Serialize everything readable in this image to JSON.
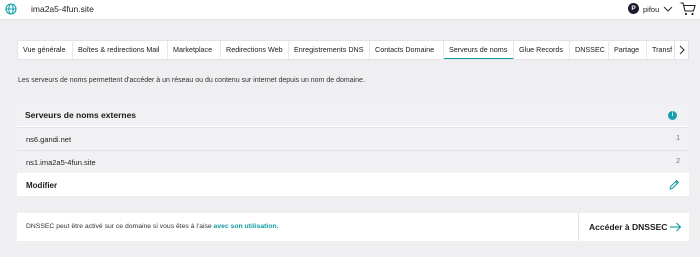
{
  "topbar": {
    "domain": "ima2a5-4fun.site",
    "avatar_initial": "P",
    "username": "pifou",
    "icons": {
      "site": "globe-icon",
      "account_menu": "chevron-down-icon",
      "cart": "cart-icon"
    }
  },
  "tabs": [
    {
      "label": "Vue générale",
      "active": false
    },
    {
      "label": "Boîtes & redirections Mail",
      "active": false
    },
    {
      "label": "Marketplace",
      "active": false
    },
    {
      "label": "Redirections Web",
      "active": false
    },
    {
      "label": "Enregistrements DNS",
      "active": false
    },
    {
      "label": "Contacts Domaine",
      "active": false
    },
    {
      "label": "Serveurs de noms",
      "active": true
    },
    {
      "label": "Glue Records",
      "active": false
    },
    {
      "label": "DNSSEC",
      "active": false
    },
    {
      "label": "Partage",
      "active": false
    },
    {
      "label": "Transf",
      "active": false
    }
  ],
  "intro_text": "Les serveurs de noms permettent d'accéder à un réseau ou du contenu sur internet depuis un nom de domaine.",
  "nameservers": {
    "title": "Serveurs de noms externes",
    "badge": "i",
    "items": [
      {
        "name": "ns6.gandi.net",
        "index": "1"
      },
      {
        "name": "ns1.ima2a5-4fun.site",
        "index": "2"
      }
    ],
    "modify_label": "Modifier"
  },
  "dnssec": {
    "text": "DNSSEC peut être activé sur ce domaine si vous êtes à l'aise ",
    "link_text": "avec son utilisation.",
    "button_label": "Accéder à DNSSEC"
  },
  "colors": {
    "accent": "#0ea2a8",
    "background": "#efeff2",
    "surface": "#ffffff",
    "row": "#f1f1f4"
  }
}
